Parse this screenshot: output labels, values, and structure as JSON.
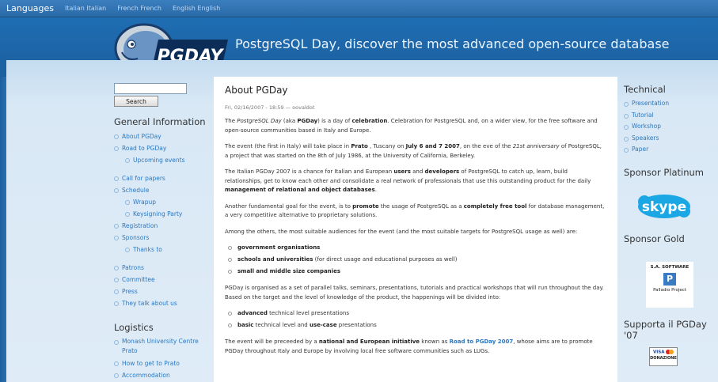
{
  "langbar": {
    "title": "Languages",
    "links": [
      "Italian Italian",
      "French French",
      "English English"
    ]
  },
  "header": {
    "logo_text": "PGDAY",
    "site_title": "PostgreSQL Day, discover the most advanced open-source database"
  },
  "left": {
    "search_button": "Search",
    "general_heading": "General Information",
    "general_items": [
      {
        "label": "About PGDay",
        "level": 0
      },
      {
        "label": "Road to PGDay",
        "level": 0
      },
      {
        "label": "Upcoming events",
        "level": 1
      },
      {
        "label": "Call for papers",
        "level": 0
      },
      {
        "label": "Schedule",
        "level": 0
      },
      {
        "label": "Wrapup",
        "level": 1
      },
      {
        "label": "Keysigning Party",
        "level": 1
      },
      {
        "label": "Registration",
        "level": 0
      },
      {
        "label": "Sponsors",
        "level": 0
      },
      {
        "label": "Thanks to",
        "level": 1
      },
      {
        "label": "Patrons",
        "level": 0
      },
      {
        "label": "Committee",
        "level": 0
      },
      {
        "label": "Press",
        "level": 0
      },
      {
        "label": "They talk about us",
        "level": 0
      }
    ],
    "logistics_heading": "Logistics",
    "logistics_items": [
      "Monash University Centre Prato",
      "How to get to Prato",
      "Accommodation"
    ]
  },
  "main": {
    "title": "About PGDay",
    "meta": "Fri, 02/16/2007 - 18:59 — oovaldot",
    "p1": [
      "The ",
      "PostgreSQL Day",
      " (aka ",
      "PGDay",
      ") is a day of ",
      "celebration",
      ". Celebration for PostgreSQL and, on a wider view, for the free software and open-source communities based in Italy and Europe."
    ],
    "p2": [
      "The event (the first in Italy) will take place in ",
      "Prato",
      " , Tuscany on ",
      "July 6 and 7 2007",
      ", on the eve of the ",
      "21st anniversary",
      " of PostgreSQL, a project that was started on the 8th of July 1986, at the University of California, Berkeley."
    ],
    "p3": [
      "The Italian PGDay 2007 is a chance for Italian and European ",
      "users",
      " and ",
      "developers",
      " of PostgreSQL to catch up, learn, build relationships, get to know each other and consolidate a real network of professionals that use this outstanding product for the daily ",
      "management of relational and object databases",
      "."
    ],
    "p4": [
      "Another fundamental goal for the event, is to ",
      "promote",
      " the usage of PostgreSQL as a ",
      "completely free tool",
      " for database management, a very competitive alternative to proprietary solutions."
    ],
    "p5": "Among the others, the most suitable audiences for the event (and the most suitable targets for PostgreSQL usage as well) are:",
    "audiences": [
      [
        "government organisations",
        ""
      ],
      [
        "schools and universities",
        " (for direct usage and educational purposes as well)"
      ],
      [
        "small and middle size companies",
        ""
      ]
    ],
    "p6": "PGDay is organised as a set of parallel talks, seminars, presentations, tutorials and practical workshops that will run throughout the day. Based on the target and the level of knowledge of the product, the happenings will be divided into:",
    "levels": [
      [
        "advanced",
        " technical level presentations"
      ],
      [
        "basic",
        " technical level and ",
        "use-case",
        " presentations"
      ]
    ],
    "p7": [
      "The event will be preceeded by a ",
      "national and European initiative",
      " known as ",
      "Road to PGDay 2007",
      ", whose aims are to promote PGDay throughout Italy and Europe by involving local free software communities such as LUGs."
    ]
  },
  "right": {
    "technical_heading": "Technical",
    "technical_items": [
      "Presentation",
      "Tutorial",
      "Workshop",
      "Speakers",
      "Paper"
    ],
    "platinum_heading": "Sponsor Platinum",
    "platinum_logo": "skype",
    "gold_heading": "Sponsor Gold",
    "gold_title": "S.A. SOFTWARE",
    "gold_caption": "Palladio Project",
    "support_heading": "Supporta il PGDay '07",
    "badge_cards": "VISA",
    "badge_label": "DONAZIONE"
  }
}
